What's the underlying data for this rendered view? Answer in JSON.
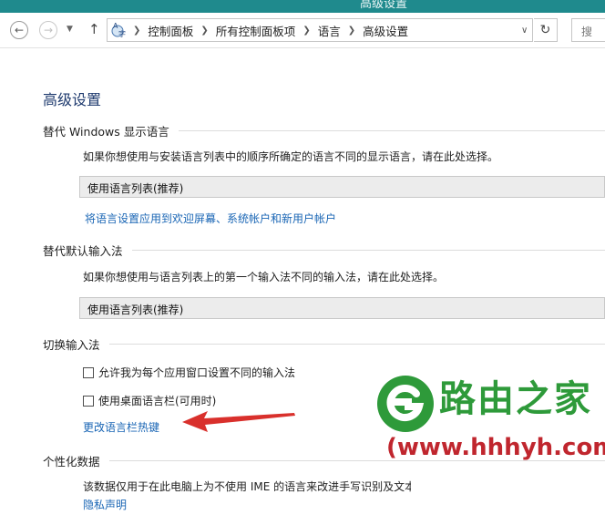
{
  "window": {
    "title": "高级设置"
  },
  "nav": {
    "breadcrumbs": [
      "控制面板",
      "所有控制面板项",
      "语言",
      "高级设置"
    ],
    "search_placeholder": "搜"
  },
  "page": {
    "title": "高级设置",
    "display_language": {
      "heading": "替代 Windows 显示语言",
      "description": "如果你想使用与安装语言列表中的顺序所确定的语言不同的显示语言，请在此处选择。",
      "selected": "使用语言列表(推荐)",
      "apply_link": "将语言设置应用到欢迎屏幕、系统帐户和新用户帐户"
    },
    "input_method": {
      "heading": "替代默认输入法",
      "description": "如果你想使用与语言列表上的第一个输入法不同的输入法，请在此处选择。",
      "selected": "使用语言列表(推荐)"
    },
    "switching": {
      "heading": "切换输入法",
      "option1": "允许我为每个应用窗口设置不同的输入法",
      "option1_checked": false,
      "option2": "使用桌面语言栏(可用时)",
      "option2_checked": false,
      "hotkey_link": "更改语言栏热键"
    },
    "personalization": {
      "heading": "个性化数据",
      "description": "该数据仅用于在此电脑上为不使用 IME 的语言来改进手写识别及文本预测",
      "privacy_link": "隐私声明"
    }
  },
  "watermark": {
    "brand": "路由之家",
    "url": "www.hhhyh.com",
    "brand_color": "#2e9a3a",
    "url_color": "#c0262e"
  },
  "colors": {
    "titlebar": "#1f8a8d",
    "link": "#1a66b5",
    "heading": "#1e3a6e",
    "arrow": "#d9302c"
  }
}
